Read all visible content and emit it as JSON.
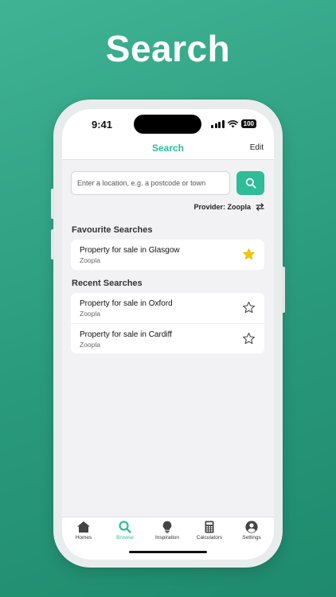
{
  "promo": {
    "title": "Search"
  },
  "status_bar": {
    "time": "9:41",
    "battery": "100"
  },
  "nav": {
    "title": "Search",
    "edit_label": "Edit"
  },
  "search": {
    "placeholder": "Enter a location, e.g. a postcode or town"
  },
  "provider": {
    "label": "Provider: Zoopla"
  },
  "favourites": {
    "title": "Favourite Searches",
    "items": [
      {
        "title": "Property for sale in Glasgow",
        "subtitle": "Zoopla",
        "starred": true
      }
    ]
  },
  "recent": {
    "title": "Recent Searches",
    "items": [
      {
        "title": "Property for sale in Oxford",
        "subtitle": "Zoopla",
        "starred": false
      },
      {
        "title": "Property for sale in Cardiff",
        "subtitle": "Zoopla",
        "starred": false
      }
    ]
  },
  "tabs": [
    {
      "label": "Homes",
      "icon": "house-icon",
      "active": false
    },
    {
      "label": "Browse",
      "icon": "search-icon",
      "active": true
    },
    {
      "label": "Inspiration",
      "icon": "lightbulb-icon",
      "active": false
    },
    {
      "label": "Calculators",
      "icon": "calculator-icon",
      "active": false
    },
    {
      "label": "Settings",
      "icon": "user-icon",
      "active": false
    }
  ],
  "colors": {
    "accent": "#2ebd98",
    "star": "#f5c800",
    "background": "#2fa584"
  }
}
